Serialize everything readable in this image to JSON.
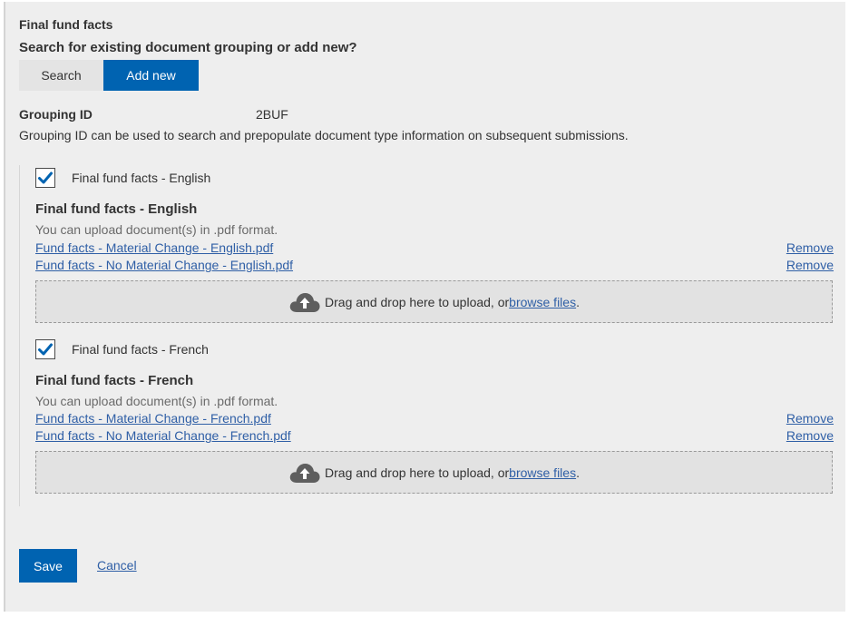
{
  "section_title": "Final fund facts",
  "question": "Search for existing document grouping or add new?",
  "toggle": {
    "search_label": "Search",
    "add_new_label": "Add new",
    "selected": "Add new"
  },
  "grouping": {
    "label": "Grouping ID",
    "value": "2BUF",
    "help": "Grouping ID can be used to search and prepopulate document type information on subsequent submissions."
  },
  "documents": [
    {
      "checked": true,
      "checkbox_label": "Final fund facts - English",
      "heading": "Final fund facts - English",
      "hint": "You can upload document(s) in .pdf format.",
      "files": [
        {
          "name": "Fund facts - Material Change - English.pdf",
          "remove_label": "Remove"
        },
        {
          "name": "Fund facts - No Material Change - English.pdf",
          "remove_label": "Remove"
        }
      ],
      "dropzone": {
        "text": "Drag and drop here to upload, or ",
        "link": "browse files",
        "suffix": "."
      }
    },
    {
      "checked": true,
      "checkbox_label": "Final fund facts - French",
      "heading": "Final fund facts - French",
      "hint": "You can upload document(s) in .pdf format.",
      "files": [
        {
          "name": "Fund facts - Material Change - French.pdf",
          "remove_label": "Remove"
        },
        {
          "name": "Fund facts - No Material Change - French.pdf",
          "remove_label": "Remove"
        }
      ],
      "dropzone": {
        "text": "Drag and drop here to upload, or ",
        "link": "browse files",
        "suffix": "."
      }
    }
  ],
  "actions": {
    "save_label": "Save",
    "cancel_label": "Cancel"
  },
  "colors": {
    "primary": "#0063b1",
    "link": "#2f5fa6",
    "panel": "#eeeeee",
    "check": "#0063b1"
  },
  "icons": {
    "checkbox": "check-icon",
    "upload": "cloud-upload-icon"
  }
}
